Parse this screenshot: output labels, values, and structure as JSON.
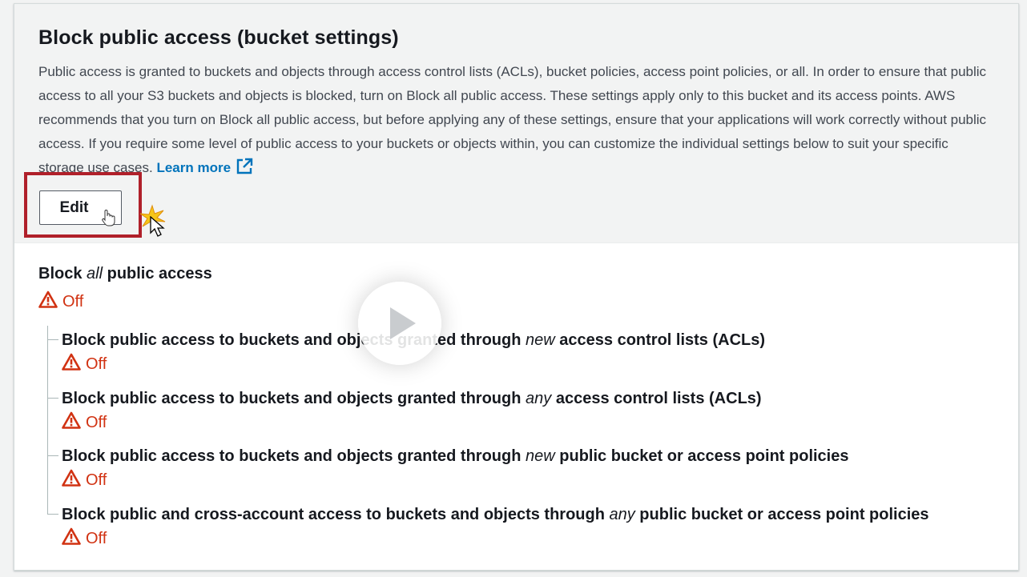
{
  "section": {
    "title": "Block public access (bucket settings)",
    "description": "Public access is granted to buckets and objects through access control lists (ACLs), bucket policies, access point policies, or all. In order to ensure that public access to all your S3 buckets and objects is blocked, turn on Block all public access. These settings apply only to this bucket and its access points. AWS recommends that you turn on Block all public access, but before applying any of these settings, ensure that your applications will work correctly without public access. If you require some level of public access to your buckets or objects within, you can customize the individual settings below to suit your specific storage use cases.",
    "learn_more": "Learn more",
    "edit_label": "Edit"
  },
  "block_all": {
    "prefix": "Block ",
    "emphasis": "all",
    "suffix": " public access",
    "status": "Off"
  },
  "settings": [
    {
      "prefix": "Block public access to buckets and objects granted through ",
      "emphasis": "new",
      "suffix": " access control lists (ACLs)",
      "status": "Off"
    },
    {
      "prefix": "Block public access to buckets and objects granted through ",
      "emphasis": "any",
      "suffix": " access control lists (ACLs)",
      "status": "Off"
    },
    {
      "prefix": "Block public access to buckets and objects granted through ",
      "emphasis": "new",
      "suffix": " public bucket or access point policies",
      "status": "Off"
    },
    {
      "prefix": "Block public and cross-account access to buckets and objects through ",
      "emphasis": "any",
      "suffix": " public bucket or access point policies",
      "status": "Off"
    }
  ],
  "icons": {
    "status_icon": "warning-triangle-icon",
    "learn_more_icon": "external-link-icon",
    "overlay": "play-icon"
  },
  "colors": {
    "warning": "#d13212",
    "link": "#0073bb",
    "highlight": "#b0202a"
  }
}
